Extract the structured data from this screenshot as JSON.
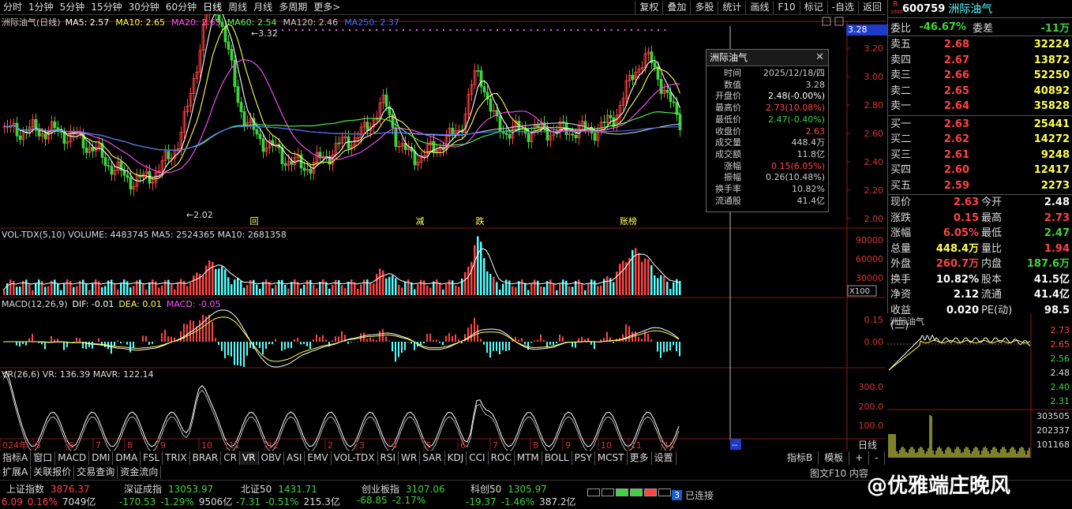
{
  "top_periods": [
    "分时",
    "1分钟",
    "5分钟",
    "15分钟",
    "30分钟",
    "60分钟",
    "日线",
    "周线",
    "月线",
    "多周期",
    "更多>"
  ],
  "top_buttons": [
    "复权",
    "叠加",
    "多股",
    "统计",
    "画线",
    "F10",
    "标记",
    "-自选",
    "返回"
  ],
  "chart_title": "洲际油气(日线)",
  "ma_legend": [
    {
      "label": "MA5: 2.57",
      "color": "#ffffff"
    },
    {
      "label": "MA10: 2.65",
      "color": "#ffff54"
    },
    {
      "label": "MA20: 2.65",
      "color": "#ff54ff"
    },
    {
      "label": "MA60: 2.54",
      "color": "#54ff54"
    },
    {
      "label": "MA120: 2.46",
      "color": "#cccccc"
    },
    {
      "label": "MA250: 2.37",
      "color": "#3f6fff"
    }
  ],
  "current_price_tag": "3.28",
  "price_axis": [
    "3.20",
    "3.00",
    "2.80",
    "2.60",
    "2.40",
    "2.20",
    "2.00"
  ],
  "high_label": "3.32",
  "low_label": "2.02",
  "event_markers": [
    "回",
    "减",
    "跌",
    "跌",
    "账榜"
  ],
  "volume_header": "VOL-TDX(5,10)  VOLUME: 4483745  MA5: 2524365  MA10: 2681358",
  "volume_axis": [
    "90000",
    "60000",
    "30000",
    "X100"
  ],
  "macd_header_name": "MACD(12,26,9)",
  "macd_header_dif": "DIF: -0.01",
  "macd_header_dea": "DEA: 0.01",
  "macd_header_macd": "MACD: -0.05",
  "macd_axis": [
    "0.15",
    "0.00"
  ],
  "vr_header": "VR(26,6)  VR: 136.39  MAVR: 122.14",
  "vr_axis": [
    "300.0",
    "200.0",
    "100.0"
  ],
  "time_axis": [
    "024年",
    "5",
    "6",
    "7",
    "8",
    "9",
    "10",
    "11",
    "12",
    "2",
    "3",
    "4",
    "5",
    "6",
    "7",
    "8",
    "9",
    "10",
    "11",
    "12"
  ],
  "time_axis_right": "日线",
  "time_axis_cursor": "--",
  "popup": {
    "title": "洲际油气",
    "rows": [
      {
        "k": "时间",
        "v": "2025/12/18/四",
        "c": "#cccccc"
      },
      {
        "k": "数值",
        "v": "3.28",
        "c": "#cccccc"
      },
      {
        "k": "开盘价",
        "v": "2.48(-0.00%)",
        "c": "#ffffff"
      },
      {
        "k": "最高价",
        "v": "2.73(10.08%)",
        "c": "#ff4444"
      },
      {
        "k": "最低价",
        "v": "2.47(-0.40%)",
        "c": "#3fd33f"
      },
      {
        "k": "收盘价",
        "v": "2.63",
        "c": "#ff4444"
      },
      {
        "k": "成交量",
        "v": "448.4万",
        "c": "#cccccc"
      },
      {
        "k": "成交额",
        "v": "11.8亿",
        "c": "#cccccc"
      },
      {
        "k": "涨幅",
        "v": "0.15(6.05%)",
        "c": "#ff4444"
      },
      {
        "k": "振幅",
        "v": "0.26(10.48%)",
        "c": "#cccccc"
      },
      {
        "k": "换手率",
        "v": "10.82%",
        "c": "#cccccc"
      },
      {
        "k": "流通股",
        "v": "41.4亿",
        "c": "#cccccc"
      }
    ]
  },
  "stock": {
    "code": "600759",
    "name": "洲际油气",
    "badge_top": "R",
    "badge_bottom": "1000"
  },
  "weibi": {
    "label": "委比",
    "value": "-46.67%",
    "label2": "委差",
    "value2": "-11万"
  },
  "sells": [
    {
      "l": "卖五",
      "p": "2.68",
      "v": "32224"
    },
    {
      "l": "卖四",
      "p": "2.67",
      "v": "13872"
    },
    {
      "l": "卖三",
      "p": "2.66",
      "v": "52250"
    },
    {
      "l": "卖二",
      "p": "2.65",
      "v": "40892"
    },
    {
      "l": "卖一",
      "p": "2.64",
      "v": "35828"
    }
  ],
  "buys": [
    {
      "l": "买一",
      "p": "2.63",
      "v": "25441"
    },
    {
      "l": "买二",
      "p": "2.62",
      "v": "14272"
    },
    {
      "l": "买三",
      "p": "2.61",
      "v": "9248"
    },
    {
      "l": "买四",
      "p": "2.60",
      "v": "12417"
    },
    {
      "l": "买五",
      "p": "2.59",
      "v": "2273"
    }
  ],
  "stats": [
    {
      "a": "现价",
      "b": "2.63",
      "bc": "#ff4444",
      "c": "今开",
      "d": "2.48",
      "dc": "#ffffff"
    },
    {
      "a": "涨跌",
      "b": "0.15",
      "bc": "#ff4444",
      "c": "最高",
      "d": "2.73",
      "dc": "#ff4444"
    },
    {
      "a": "涨幅",
      "b": "6.05%",
      "bc": "#ff4444",
      "c": "最低",
      "d": "2.47",
      "dc": "#3fd33f"
    },
    {
      "a": "总量",
      "b": "448.4万",
      "bc": "#ffff54",
      "c": "量比",
      "d": "1.94",
      "dc": "#ff4444"
    },
    {
      "a": "外盘",
      "b": "260.7万",
      "bc": "#ff4444",
      "c": "内盘",
      "d": "187.6万",
      "dc": "#3fd33f"
    },
    {
      "a": "换手",
      "b": "10.82%",
      "bc": "#ffffff",
      "c": "股本",
      "d": "41.5亿",
      "dc": "#ffffff"
    },
    {
      "a": "净资",
      "b": "2.12",
      "bc": "#ffffff",
      "c": "流通",
      "d": "41.4亿",
      "dc": "#ffffff"
    },
    {
      "a": "收益(三)",
      "b": "0.020",
      "bc": "#ffffff",
      "c": "PE(动)",
      "d": "98.5",
      "dc": "#ffffff"
    }
  ],
  "mini_title": "洲际油气",
  "mini_axis_price": [
    "2.73",
    "2.65",
    "2.56",
    "2.48",
    "2.40",
    "2.31"
  ],
  "mini_axis_vol": [
    "303505",
    "202337",
    "101168"
  ],
  "bottom_tabs": [
    "指标A",
    "窗口",
    "MACD",
    "DMI",
    "DMA",
    "FSL",
    "TRIX",
    "BRAR",
    "CR",
    "VR",
    "OBV",
    "ASI",
    "EMV",
    "VOL-TDX",
    "RSI",
    "WR",
    "SAR",
    "KDJ",
    "CCI",
    "ROC",
    "MTM",
    "BOLL",
    "PSY",
    "MCST",
    "更多",
    "设置"
  ],
  "bottom_right_tabs": [
    "指标B",
    "模板",
    "+",
    "-"
  ],
  "status_tabs": [
    "扩展A",
    "关联报价",
    "交易查询",
    "资金流向"
  ],
  "status_right": "图文F10 内容",
  "indices": [
    {
      "name": "上证指数",
      "val": "3876.37",
      "chg": "6.09",
      "pct": "0.16%",
      "amt": "7049亿",
      "color": "#ff4444"
    },
    {
      "name": "深证成指",
      "val": "13053.97",
      "chg": "-170.53",
      "pct": "-1.29%",
      "amt": "9506亿",
      "color": "#3fd33f"
    },
    {
      "name": "北证50",
      "val": "1431.71",
      "chg": "-7.31",
      "pct": "-0.51%",
      "amt": "215.3亿",
      "color": "#3fd33f"
    },
    {
      "name": "创业板指",
      "val": "3107.06",
      "chg": "-68.85",
      "pct": "-2.17%",
      "amt": "",
      "color": "#3fd33f"
    },
    {
      "name": "科创50",
      "val": "1305.97",
      "chg": "-19.37",
      "pct": "-1.46%",
      "amt": "387.2亿",
      "color": "#3fd33f"
    }
  ],
  "connection": {
    "badge": "3",
    "text": "已连接"
  },
  "watermark": "@优雅端庄晚风",
  "colors": {
    "up": "#ff4444",
    "down": "#3fd33f",
    "bg": "#000000",
    "axis": "#8b1a1a",
    "vol_ma": "#ffffff",
    "mavr": "#ffffff"
  }
}
